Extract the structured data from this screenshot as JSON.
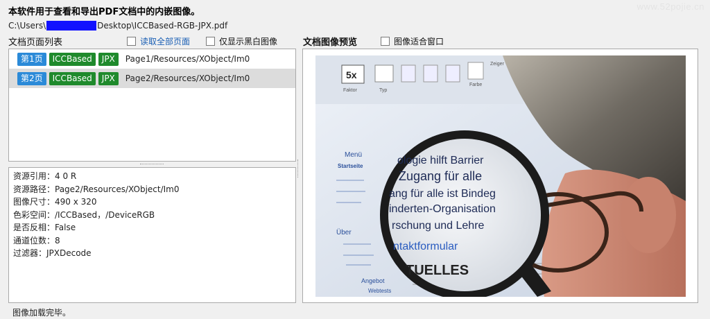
{
  "header": {
    "heading": "本软件用于查看和导出PDF文档中的内嵌图像。",
    "watermark": "www.52pojie.cn",
    "path_prefix": "C:\\Users\\",
    "path_suffix": "Desktop\\ICCBased-RGB-JPX.pdf"
  },
  "list_panel": {
    "label": "文档页面列表",
    "read_all_label": "读取全部页面",
    "read_all_checked": false,
    "only_bw_label": "仅显示黑白图像",
    "only_bw_checked": false,
    "rows": [
      {
        "page": "第1页",
        "colorspace": "ICCBased",
        "format": "JPX",
        "path": "Page1/Resources/XObject/Im0",
        "selected": false
      },
      {
        "page": "第2页",
        "colorspace": "ICCBased",
        "format": "JPX",
        "path": "Page2/Resources/XObject/Im0",
        "selected": true
      }
    ]
  },
  "info": {
    "ref": "资源引用：4 0 R",
    "res_path": "资源路径：Page2/Resources/XObject/Im0",
    "size": "图像尺寸：490 x 320",
    "colorspace": "色彩空间：/ICCBased，/DeviceRGB",
    "inverted": "是否反相：False",
    "bits": "通道位数：8",
    "filter": "过滤器：JPXDecode"
  },
  "preview": {
    "label": "文档图像预览",
    "fit_label": "图像适合窗口",
    "fit_checked": false,
    "image_text": {
      "toolbar_5x": "5x",
      "toolbar_faktor": "Faktor",
      "toolbar_typ": "Typ",
      "toolbar_farbe": "Farbe",
      "toolbar_zeiger": "Zeiger",
      "menu": "Menü",
      "startseite": "Startseite",
      "mag_line1": "ologie hilft Barrier",
      "mag_line2": "Zugang für alle",
      "mag_line3": "ang für alle ist Bindeg",
      "mag_line4": "inderten-Organisation",
      "mag_line5": "rschung und Lehre",
      "mag_link": "ntaktformular",
      "mag_aktuelles": "TUELLES",
      "uber": "Über",
      "angebot": "Angebot",
      "webtests": "Webtests"
    }
  },
  "status": {
    "text": "图像加载完毕。"
  },
  "colors": {
    "tag_blue": "#2b8ad8",
    "tag_green": "#1f8a2c",
    "selected_row": "#dcdcdc",
    "link_blue": "#1a5fb4"
  }
}
